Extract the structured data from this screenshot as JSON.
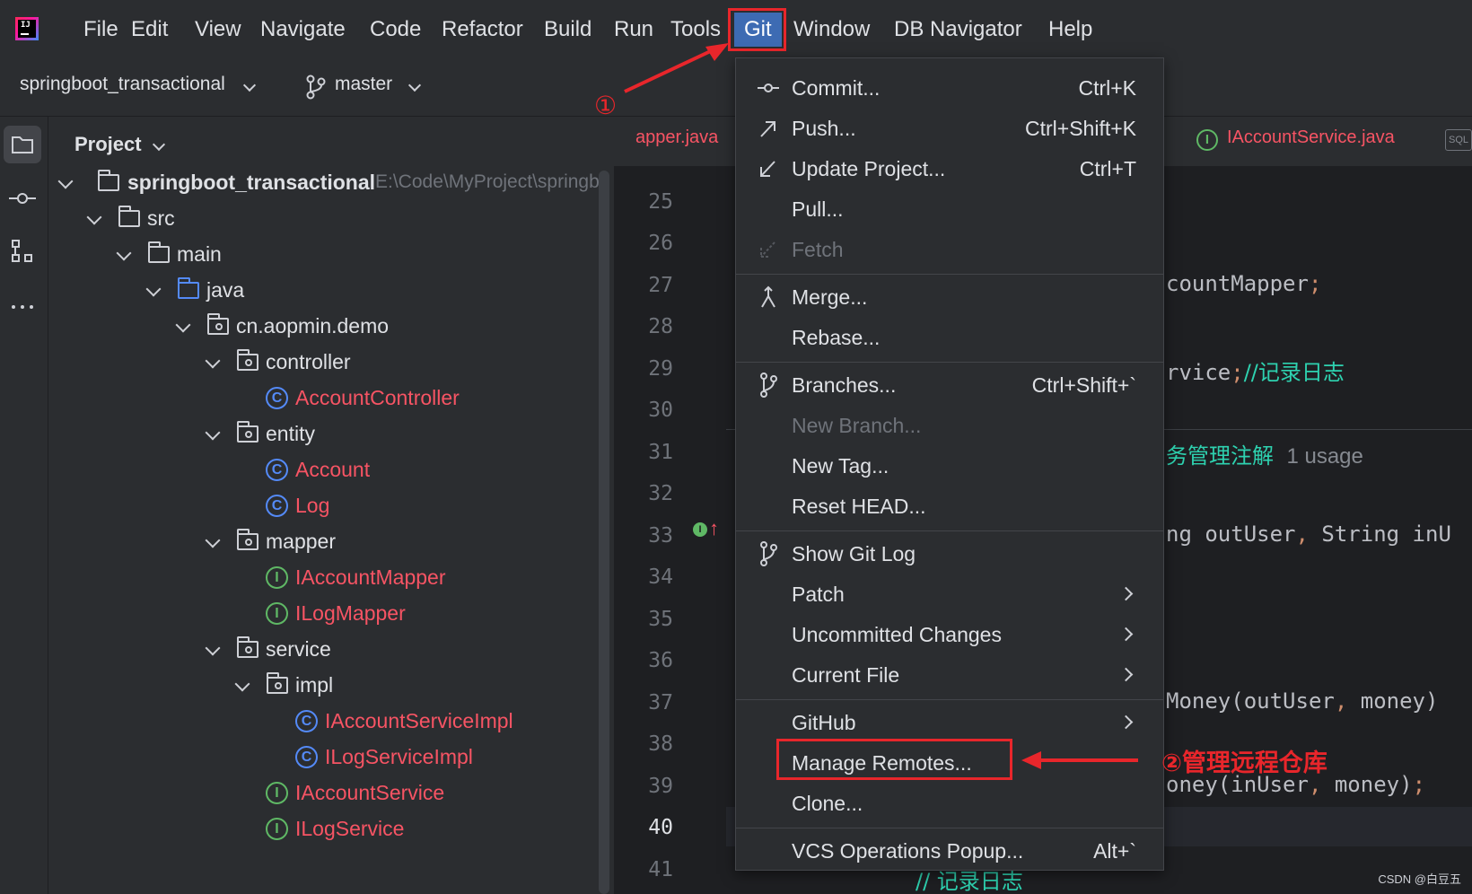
{
  "app": {
    "logo_text": "IJ"
  },
  "menubar": {
    "items": [
      "File",
      "Edit",
      "View",
      "Navigate",
      "Code",
      "Refactor",
      "Build",
      "Run",
      "Tools",
      "Git",
      "Window",
      "DB Navigator",
      "Help"
    ],
    "active": "Git"
  },
  "toolbar": {
    "project": "springboot_transactional",
    "branch": "master"
  },
  "project_panel": {
    "title": "Project",
    "root_name": "springboot_transactional",
    "root_path": "E:\\Code\\MyProject\\springb",
    "tree": [
      "src",
      "main",
      "java",
      "cn.aopmin.demo",
      "controller",
      "AccountController",
      "entity",
      "Account",
      "Log",
      "mapper",
      "IAccountMapper",
      "ILogMapper",
      "service",
      "impl",
      "IAccountServiceImpl",
      "ILogServiceImpl",
      "IAccountService",
      "ILogService"
    ],
    "class_icon": "C",
    "interface_icon": "I"
  },
  "editor": {
    "tabs": [
      "apper.java",
      "IAccountService.java"
    ],
    "sql_tab": "SQL",
    "line_numbers": [
      "25",
      "26",
      "27",
      "28",
      "29",
      "30",
      "31",
      "32",
      "33",
      "34",
      "35",
      "36",
      "37",
      "38",
      "39",
      "40",
      "41"
    ],
    "code": {
      "l27": "countMapper",
      "l29a": "rvice",
      "l29b": "//记录日志",
      "l31a": "务管理注解",
      "l31b": "1 usage",
      "l33a": "ng outUser",
      "l33b": " String inU",
      "l36": "Money(outUser",
      "l36b": " money)",
      "l39": "oney(inUser",
      "l39b": " money)",
      "l41": "// 记录日志",
      "semicolon": ";",
      "comma": ","
    }
  },
  "git_menu": {
    "items": [
      {
        "label": "Commit...",
        "shortcut": "Ctrl+K"
      },
      {
        "label": "Push...",
        "shortcut": "Ctrl+Shift+K"
      },
      {
        "label": "Update Project...",
        "shortcut": "Ctrl+T"
      },
      {
        "label": "Pull...",
        "shortcut": ""
      },
      {
        "label": "Fetch",
        "shortcut": ""
      },
      {
        "label": "Merge...",
        "shortcut": ""
      },
      {
        "label": "Rebase...",
        "shortcut": ""
      },
      {
        "label": "Branches...",
        "shortcut": "Ctrl+Shift+`"
      },
      {
        "label": "New Branch...",
        "shortcut": ""
      },
      {
        "label": "New Tag...",
        "shortcut": ""
      },
      {
        "label": "Reset HEAD...",
        "shortcut": ""
      },
      {
        "label": "Show Git Log",
        "shortcut": ""
      },
      {
        "label": "Patch",
        "shortcut": ""
      },
      {
        "label": "Uncommitted Changes",
        "shortcut": ""
      },
      {
        "label": "Current File",
        "shortcut": ""
      },
      {
        "label": "GitHub",
        "shortcut": ""
      },
      {
        "label": "Manage Remotes...",
        "shortcut": ""
      },
      {
        "label": "Clone...",
        "shortcut": ""
      },
      {
        "label": "VCS Operations Popup...",
        "shortcut": "Alt+`"
      }
    ]
  },
  "annotations": {
    "step1": "①",
    "step2": "②管理远程仓库"
  },
  "watermark": "CSDN @白豆五",
  "colors": {
    "accent": "#3d6bb3",
    "annotation_red": "#e8262b",
    "class_blue": "#548af7",
    "interface_green": "#5fb865"
  }
}
